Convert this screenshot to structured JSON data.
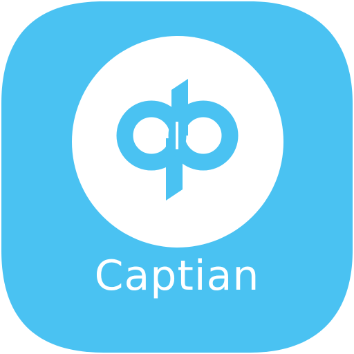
{
  "app": {
    "name": "Captian"
  },
  "icon": {
    "shape": "rounded-square",
    "logo_name": "dp-monogram-icon"
  },
  "colors": {
    "background": "#4ac2f2",
    "foreground": "#ffffff"
  }
}
